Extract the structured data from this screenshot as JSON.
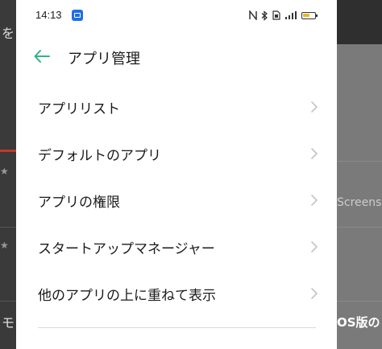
{
  "status_bar": {
    "time": "14:13",
    "icons": [
      "nfc-icon",
      "bluetooth-icon",
      "sim-icon",
      "signal-icon",
      "battery-icon"
    ]
  },
  "header": {
    "title": "アプリ管理",
    "back_icon": "back-arrow-icon"
  },
  "menu": {
    "items": [
      {
        "label": "アプリリスト"
      },
      {
        "label": "デフォルトのアプリ"
      },
      {
        "label": "アプリの権限"
      },
      {
        "label": "スタートアップマネージャー"
      },
      {
        "label": "他のアプリの上に重ねて表示"
      }
    ]
  },
  "background": {
    "left_texts": [
      "を",
      "モ"
    ],
    "right_texts": [
      "Screens",
      "OS版の"
    ]
  },
  "colors": {
    "accent": "#2fb38a",
    "text": "#1a1a1a",
    "chevron": "#c4c4c4",
    "divider": "#d9d9d9"
  }
}
